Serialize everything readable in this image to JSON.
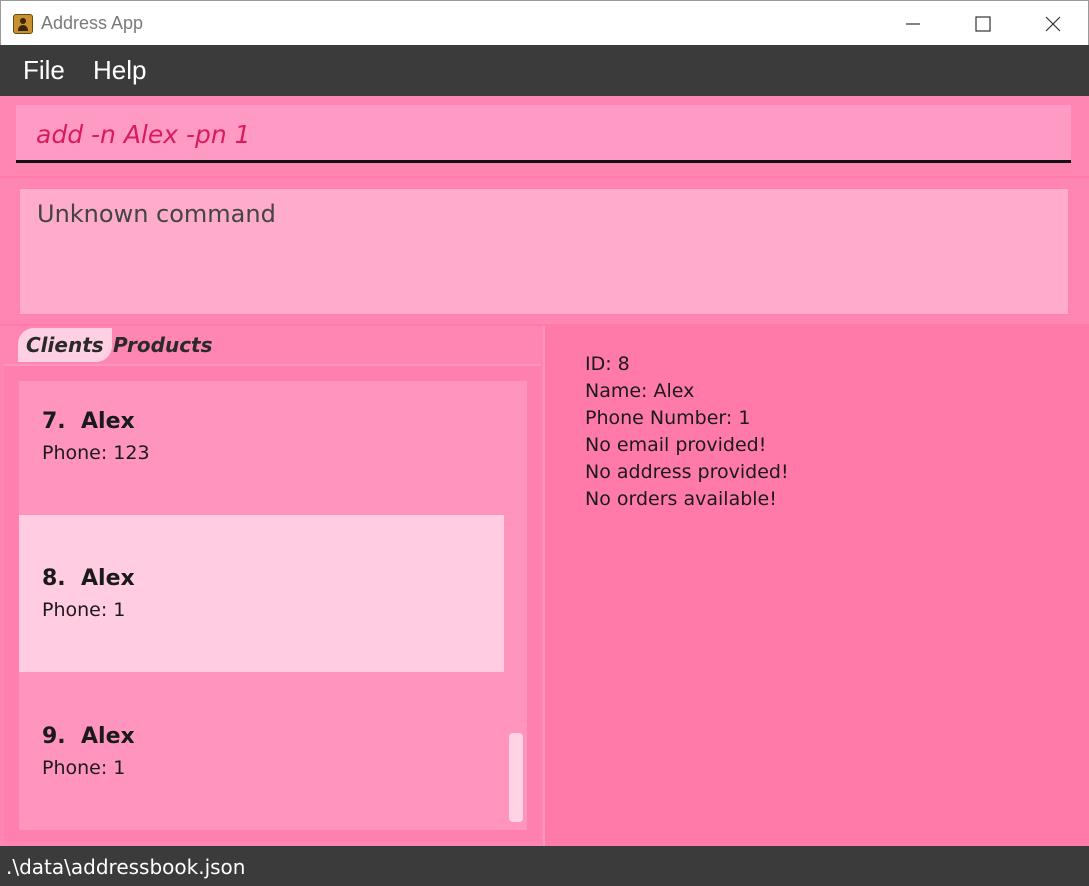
{
  "window": {
    "title": "Address App",
    "icon": "address-book-icon"
  },
  "menu": {
    "file": "File",
    "help": "Help"
  },
  "command": {
    "value": "add -n Alex -pn 1"
  },
  "result": {
    "text": "Unknown command"
  },
  "tabs": {
    "clients": "Clients",
    "products": "Products",
    "active": "Clients"
  },
  "clients": [
    {
      "index": "7.",
      "name": "Alex",
      "phone": "Phone: 123",
      "selected": false
    },
    {
      "index": "8.",
      "name": "Alex",
      "phone": "Phone: 1",
      "selected": true
    },
    {
      "index": "9.",
      "name": "Alex",
      "phone": "Phone: 1",
      "selected": false
    }
  ],
  "detail": {
    "id": "ID: 8",
    "name": "Name: Alex",
    "phone": "Phone Number: 1",
    "email": "No email provided!",
    "address": "No address provided!",
    "orders": "No orders available!"
  },
  "status": {
    "path": ".\\data\\addressbook.json"
  },
  "colors": {
    "background": "#ff7aa8",
    "command_text": "#d81b5c",
    "selected_card": "#ffcce1",
    "menubar": "#3b3b3b"
  }
}
